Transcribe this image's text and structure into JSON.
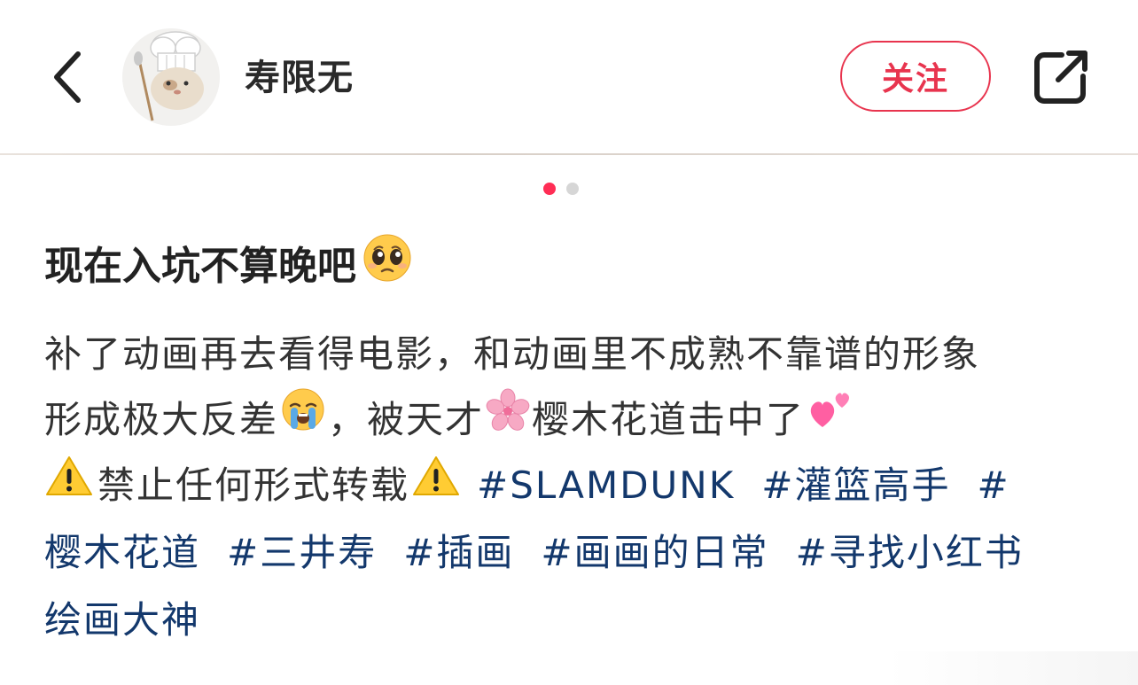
{
  "header": {
    "username": "寿限无",
    "follow_label": "关注",
    "back_icon": "chevron-left-icon",
    "share_icon": "share-external-icon",
    "avatar": "chef-hat-cat-avatar"
  },
  "carousel": {
    "total": 2,
    "active": 1,
    "active_color": "#ff2d55",
    "inactive_color": "#d6d6d6"
  },
  "post": {
    "title": "现在入坑不算晚吧",
    "title_emoji": "pleading-face-emoji",
    "line1": "补了动画再去看得电影，和动画里不成熟不靠谱的形象",
    "line2_a": "形成极大反差",
    "line2_b": "，被天才",
    "line2_c": "樱木花道击中了",
    "warning_text": "禁止任何形式转载",
    "tags": [
      "#SLAMDUNK",
      "#灌篮高手",
      "#",
      "樱木花道",
      "#三井寿",
      "#插画",
      "#画画的日常",
      "#寻找小红书",
      "绘画大神"
    ],
    "tag_color": "#13386c"
  },
  "colors": {
    "accent": "#e8344e",
    "text": "#333333"
  }
}
